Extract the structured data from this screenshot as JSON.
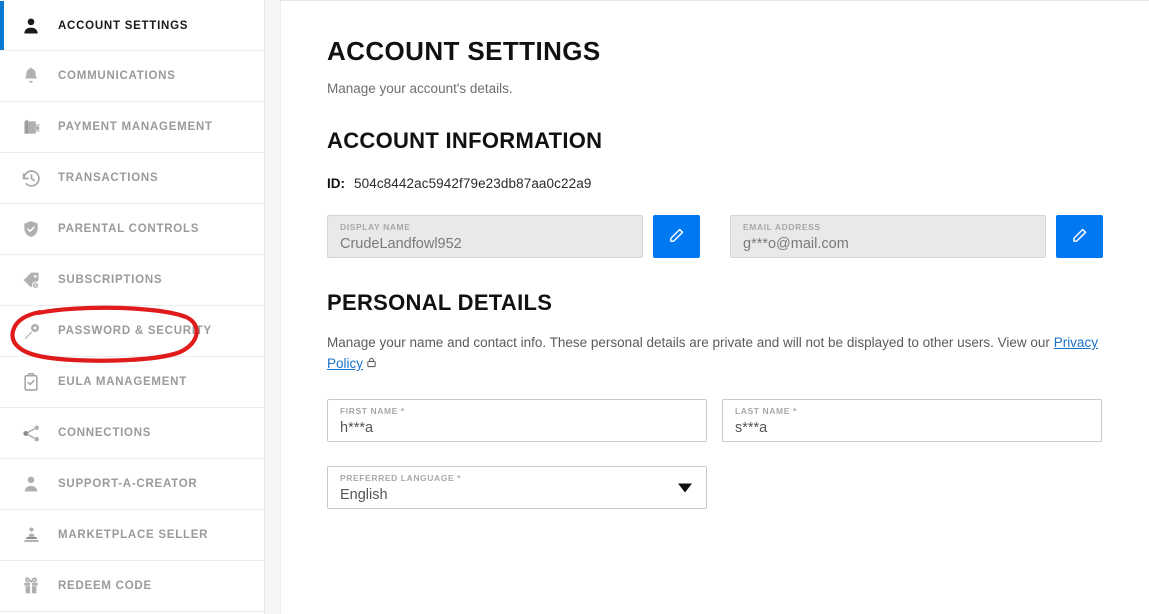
{
  "sidebar": {
    "items": [
      {
        "label": "ACCOUNT SETTINGS",
        "icon": "person-icon",
        "active": true
      },
      {
        "label": "COMMUNICATIONS",
        "icon": "bell-icon",
        "active": false
      },
      {
        "label": "PAYMENT MANAGEMENT",
        "icon": "wallet-icon",
        "active": false
      },
      {
        "label": "TRANSACTIONS",
        "icon": "history-clock-icon",
        "active": false
      },
      {
        "label": "PARENTAL CONTROLS",
        "icon": "shield-check-icon",
        "active": false
      },
      {
        "label": "SUBSCRIPTIONS",
        "icon": "price-tag-icon",
        "active": false
      },
      {
        "label": "PASSWORD & SECURITY",
        "icon": "key-icon",
        "active": false
      },
      {
        "label": "EULA MANAGEMENT",
        "icon": "clipboard-check-icon",
        "active": false
      },
      {
        "label": "CONNECTIONS",
        "icon": "share-nodes-icon",
        "active": false
      },
      {
        "label": "SUPPORT-A-CREATOR",
        "icon": "person-outline-icon",
        "active": false
      },
      {
        "label": "MARKETPLACE SELLER",
        "icon": "seller-podium-icon",
        "active": false
      },
      {
        "label": "REDEEM CODE",
        "icon": "gift-icon",
        "active": false
      }
    ],
    "active_accent_color": "#0b79d0"
  },
  "main": {
    "page_title": "ACCOUNT SETTINGS",
    "page_subtitle": "Manage your account's details.",
    "account_information": {
      "section_title": "ACCOUNT INFORMATION",
      "id_key": "ID:",
      "id_value": "504c8442ac5942f79e23db87aa0c22a9",
      "display_name": {
        "label": "DISPLAY NAME",
        "value": "CrudeLandfowl952",
        "edit_button_label": "pencil-icon"
      },
      "email_address": {
        "label": "EMAIL ADDRESS",
        "value": "g***o@mail.com",
        "edit_button_label": "pencil-icon"
      }
    },
    "personal_details": {
      "section_title": "PERSONAL DETAILS",
      "description_before_link": "Manage your name and contact info. These personal details are private and will not be displayed to other users. View our ",
      "link_text": "Privacy Policy",
      "first_name": {
        "label": "FIRST NAME *",
        "value": "h***a"
      },
      "last_name": {
        "label": "LAST NAME *",
        "value": "s***a"
      },
      "preferred_language": {
        "label": "PREFERRED LANGUAGE *",
        "value": "English"
      }
    }
  },
  "theme": {
    "accent_blue": "#0078f2",
    "link_blue": "#1a73cc",
    "annotation_red": "#e01b1b",
    "sidebar_label_gray": "#9a9a9a"
  },
  "annotation": {
    "shape": "hand-drawn-ellipse",
    "color": "#e01b1b",
    "targets": "PASSWORD & SECURITY"
  }
}
